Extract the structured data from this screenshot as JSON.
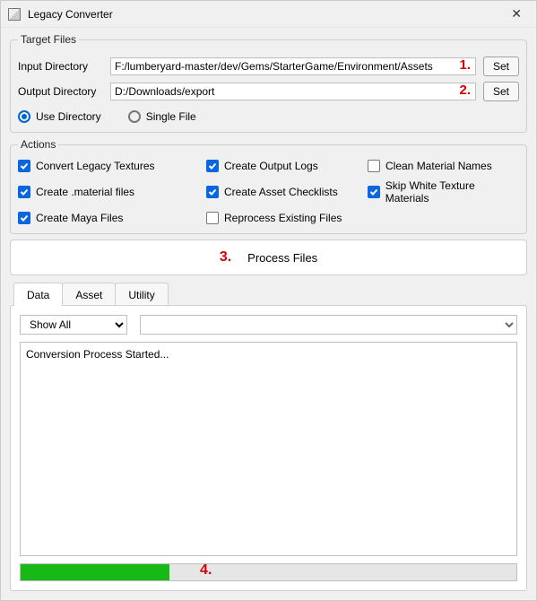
{
  "window": {
    "title": "Legacy Converter"
  },
  "target_files": {
    "legend": "Target Files",
    "input_label": "Input Directory",
    "input_value": "F:/lumberyard-master/dev/Gems/StarterGame/Environment/Assets",
    "output_label": "Output Directory",
    "output_value": "D:/Downloads/export",
    "set_label": "Set",
    "use_directory_label": "Use Directory",
    "single_file_label": "Single File",
    "mode": "directory"
  },
  "actions": {
    "legend": "Actions",
    "items": [
      {
        "label": "Convert Legacy Textures",
        "checked": true
      },
      {
        "label": "Create Output Logs",
        "checked": true
      },
      {
        "label": "Clean Material Names",
        "checked": false
      },
      {
        "label": "Create .material files",
        "checked": true
      },
      {
        "label": "Create Asset Checklists",
        "checked": true
      },
      {
        "label": "Skip White Texture Materials",
        "checked": true
      },
      {
        "label": "Create Maya Files",
        "checked": true
      },
      {
        "label": "Reprocess Existing Files",
        "checked": false
      }
    ]
  },
  "process": {
    "button_label": "Process Files"
  },
  "tabs": {
    "items": [
      {
        "label": "Data",
        "active": true
      },
      {
        "label": "Asset",
        "active": false
      },
      {
        "label": "Utility",
        "active": false
      }
    ],
    "filter_options_label": "Show All",
    "log_text": "Conversion Process Started..."
  },
  "progress": {
    "percent": 30
  },
  "annotations": {
    "one": "1.",
    "two": "2.",
    "three": "3.",
    "four": "4."
  }
}
